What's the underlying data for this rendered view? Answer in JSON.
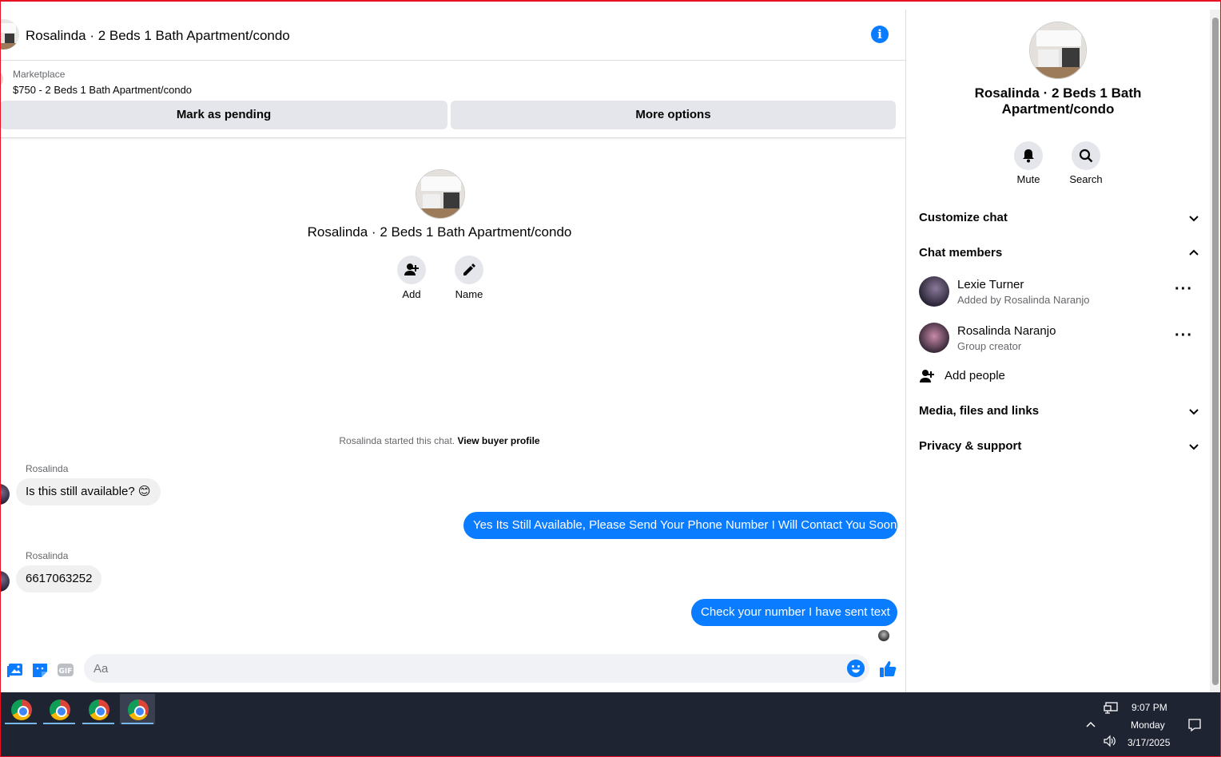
{
  "header": {
    "title": "Rosalinda · 2 Beds 1 Bath Apartment/condo",
    "info_icon": "info-icon"
  },
  "marketplace": {
    "label": "Marketplace",
    "listing": "$750 - 2 Beds 1 Bath Apartment/condo",
    "mark_pending": "Mark as pending",
    "more_options": "More options"
  },
  "intro": {
    "title": "Rosalinda · 2 Beds 1 Bath Apartment/condo",
    "add_label": "Add",
    "name_label": "Name"
  },
  "system_note": {
    "text": "Rosalinda started this chat. ",
    "link": "View buyer profile"
  },
  "messages": [
    {
      "sender": "Rosalinda",
      "text": "Is this still available? 😊",
      "direction": "in"
    },
    {
      "text": "Yes Its Still Available, Please Send Your Phone Number I Will Contact You Soon.",
      "direction": "out"
    },
    {
      "sender": "Rosalinda",
      "text": "6617063252",
      "direction": "in"
    },
    {
      "text": "Check your number I have sent text",
      "direction": "out"
    }
  ],
  "composer": {
    "placeholder": "Aa",
    "gif_label": "GIF"
  },
  "side": {
    "title": "Rosalinda · 2 Beds 1 Bath Apartment/condo",
    "mute": "Mute",
    "search": "Search",
    "customize_chat": "Customize chat",
    "chat_members": "Chat members",
    "members": [
      {
        "name": "Lexie Turner",
        "sub": "Added by Rosalinda Naranjo"
      },
      {
        "name": "Rosalinda Naranjo",
        "sub": "Group creator"
      }
    ],
    "add_people": "Add people",
    "media": "Media, files and links",
    "privacy": "Privacy & support"
  },
  "taskbar": {
    "time": "9:07 PM",
    "day": "Monday",
    "date": "3/17/2025"
  },
  "colors": {
    "accent": "#0a7cff",
    "taskbar": "#1f2433"
  }
}
